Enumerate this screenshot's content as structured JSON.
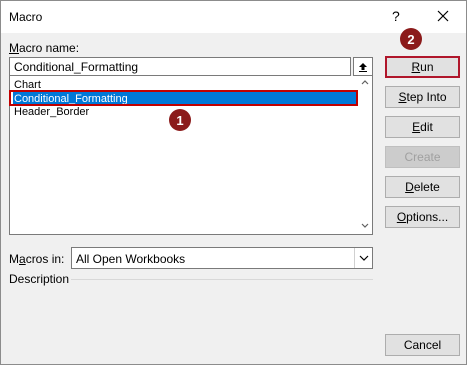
{
  "window": {
    "title": "Macro",
    "help": "?"
  },
  "macro_name": {
    "label_u": "M",
    "label_rest": "acro name:",
    "value": "Conditional_Formatting"
  },
  "macros": [
    {
      "name": "Chart"
    },
    {
      "name": "Conditional_Formatting",
      "selected": true
    },
    {
      "name": "Header_Border"
    }
  ],
  "badges": {
    "one": "1",
    "two": "2"
  },
  "buttons": {
    "run": {
      "u": "R",
      "rest": "un"
    },
    "step_into": {
      "u": "S",
      "rest": "tep Into"
    },
    "edit": {
      "u": "E",
      "rest": "dit"
    },
    "create": {
      "label": "Create",
      "disabled": true
    },
    "delete": {
      "u": "D",
      "rest": "elete"
    },
    "options": {
      "u": "O",
      "rest": "ptions..."
    },
    "cancel": {
      "label": "Cancel"
    }
  },
  "macros_in": {
    "label_pre": "M",
    "label_u": "a",
    "label_rest": "cros in:",
    "value": "All Open Workbooks"
  },
  "description": {
    "label": "Description"
  },
  "colors": {
    "selection": "#0078d7",
    "annotation_red": "#c00000",
    "badge": "#8b1a1a"
  }
}
